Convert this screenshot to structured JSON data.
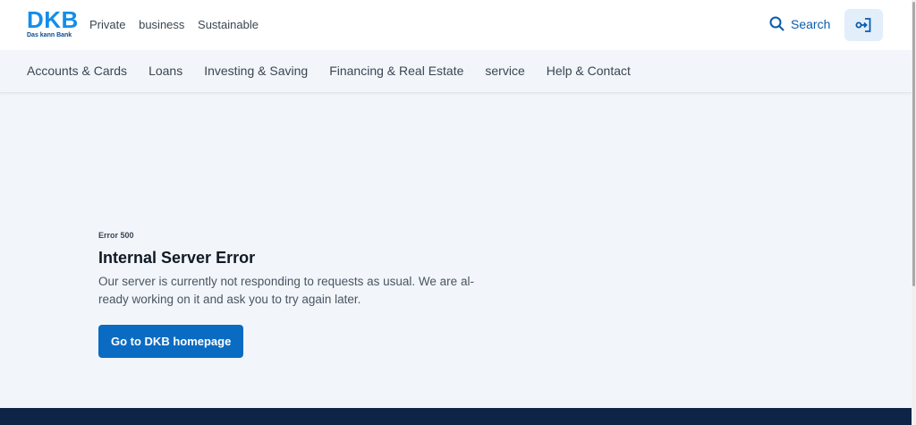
{
  "header": {
    "logo": {
      "wordmark": "DKB",
      "claim": "Das kann Bank"
    },
    "segments": [
      "Private",
      "business",
      "Sustainable"
    ],
    "search_label": "Search",
    "login_icon": "login-icon"
  },
  "main_nav": {
    "items": [
      "Accounts & Cards",
      "Loans",
      "Investing & Saving",
      "Financing & Real Estate",
      "service",
      "Help & Contact"
    ]
  },
  "error": {
    "code": "Error 500",
    "title": "Internal Server Error",
    "message": "Our server is currently not responding to requests as usual. We are al-ready working on it and ask you to try again later.",
    "button_label": "Go to DKB homepage"
  },
  "colors": {
    "brand_blue": "#148dea",
    "button_blue": "#0a6bc2",
    "footer_navy": "#0d2447",
    "page_background": "#f2f6fb"
  }
}
